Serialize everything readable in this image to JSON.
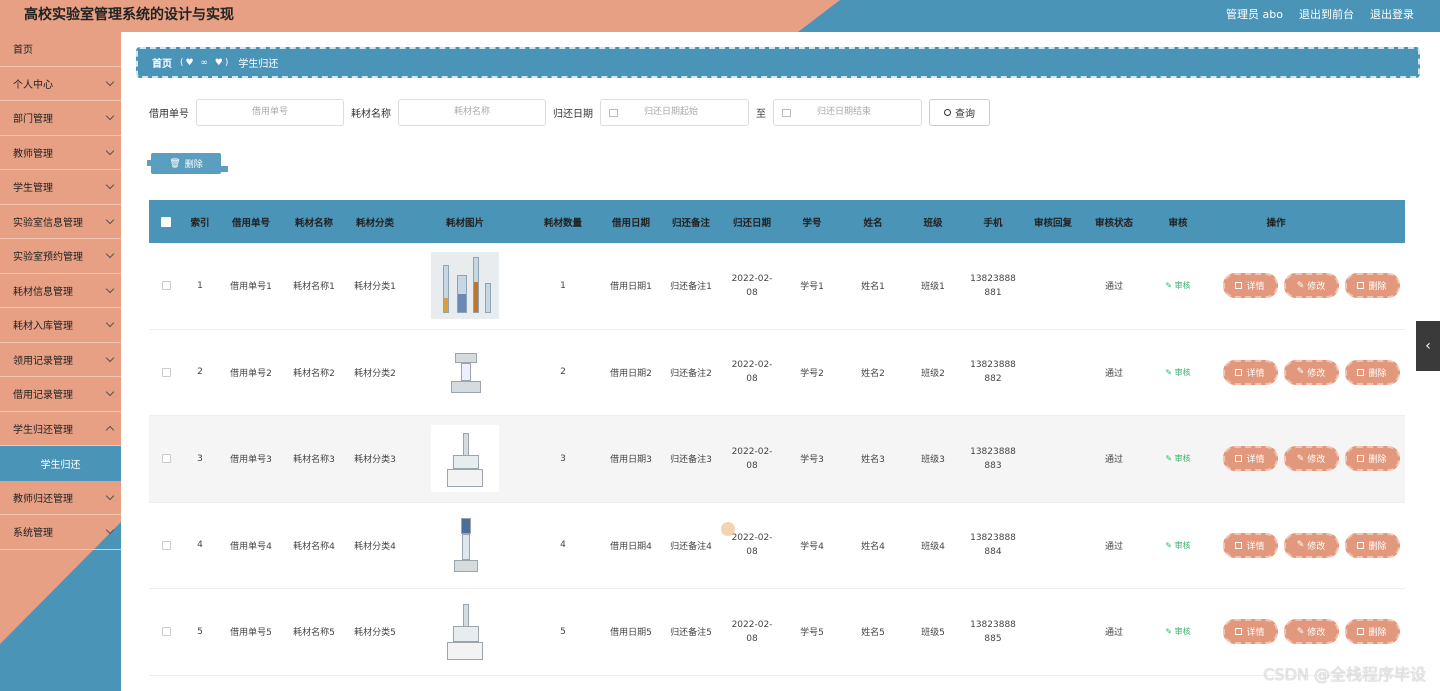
{
  "header": {
    "title": "高校实验室管理系统的设计与实现",
    "admin": "管理员 abo",
    "back_front": "退出到前台",
    "logout": "退出登录"
  },
  "sidebar": {
    "items": [
      {
        "label": "首页"
      },
      {
        "label": "个人中心"
      },
      {
        "label": "部门管理"
      },
      {
        "label": "教师管理"
      },
      {
        "label": "学生管理"
      },
      {
        "label": "实验室信息管理"
      },
      {
        "label": "实验室预约管理"
      },
      {
        "label": "耗材信息管理"
      },
      {
        "label": "耗材入库管理"
      },
      {
        "label": "领用记录管理"
      },
      {
        "label": "借用记录管理"
      },
      {
        "label": "学生归还管理"
      },
      {
        "label": "学生归还"
      },
      {
        "label": "教师归还管理"
      },
      {
        "label": "系统管理"
      }
    ]
  },
  "breadcrumb": {
    "home": "首页",
    "sep": "(♥ ∞ ♥)",
    "current": "学生归还"
  },
  "search": {
    "borrow_no_label": "借用单号",
    "borrow_no_placeholder": "借用单号",
    "material_label": "耗材名称",
    "material_placeholder": "耗材名称",
    "return_date_label": "归还日期",
    "date_start": "归还日期起始",
    "date_sep": "至",
    "date_end": "归还日期结束",
    "query": "查询"
  },
  "toolbar": {
    "delete": "删除"
  },
  "table": {
    "columns": [
      "索引",
      "借用单号",
      "耗材名称",
      "耗材分类",
      "耗材图片",
      "耗材数量",
      "借用日期",
      "归还备注",
      "归还日期",
      "学号",
      "姓名",
      "班级",
      "手机",
      "审核回复",
      "审核状态",
      "审核",
      "操作"
    ],
    "rows": [
      {
        "idx": "1",
        "no": "借用单号1",
        "name": "耗材名称1",
        "cat": "耗材分类1",
        "qty": "1",
        "bdate": "借用日期1",
        "note": "归还备注1",
        "rdate1": "2022-02-",
        "rdate2": "08",
        "sid": "学号1",
        "sname": "姓名1",
        "cls": "班级1",
        "phone1": "13823888",
        "phone2": "881",
        "reply": "",
        "status": "通过",
        "audit": "审核"
      },
      {
        "idx": "2",
        "no": "借用单号2",
        "name": "耗材名称2",
        "cat": "耗材分类2",
        "qty": "2",
        "bdate": "借用日期2",
        "note": "归还备注2",
        "rdate1": "2022-02-",
        "rdate2": "08",
        "sid": "学号2",
        "sname": "姓名2",
        "cls": "班级2",
        "phone1": "13823888",
        "phone2": "882",
        "reply": "",
        "status": "通过",
        "audit": "审核"
      },
      {
        "idx": "3",
        "no": "借用单号3",
        "name": "耗材名称3",
        "cat": "耗材分类3",
        "qty": "3",
        "bdate": "借用日期3",
        "note": "归还备注3",
        "rdate1": "2022-02-",
        "rdate2": "08",
        "sid": "学号3",
        "sname": "姓名3",
        "cls": "班级3",
        "phone1": "13823888",
        "phone2": "883",
        "reply": "",
        "status": "通过",
        "audit": "审核"
      },
      {
        "idx": "4",
        "no": "借用单号4",
        "name": "耗材名称4",
        "cat": "耗材分类4",
        "qty": "4",
        "bdate": "借用日期4",
        "note": "归还备注4",
        "rdate1": "2022-02-",
        "rdate2": "08",
        "sid": "学号4",
        "sname": "姓名4",
        "cls": "班级4",
        "phone1": "13823888",
        "phone2": "884",
        "reply": "",
        "status": "通过",
        "audit": "审核"
      },
      {
        "idx": "5",
        "no": "借用单号5",
        "name": "耗材名称5",
        "cat": "耗材分类5",
        "qty": "5",
        "bdate": "借用日期5",
        "note": "归还备注5",
        "rdate1": "2022-02-",
        "rdate2": "08",
        "sid": "学号5",
        "sname": "姓名5",
        "cls": "班级5",
        "phone1": "13823888",
        "phone2": "885",
        "reply": "",
        "status": "通过",
        "audit": "审核"
      }
    ],
    "op_detail": "详情",
    "op_edit": "修改",
    "op_delete": "删除"
  },
  "watermark": "CSDN @全栈程序毕设"
}
